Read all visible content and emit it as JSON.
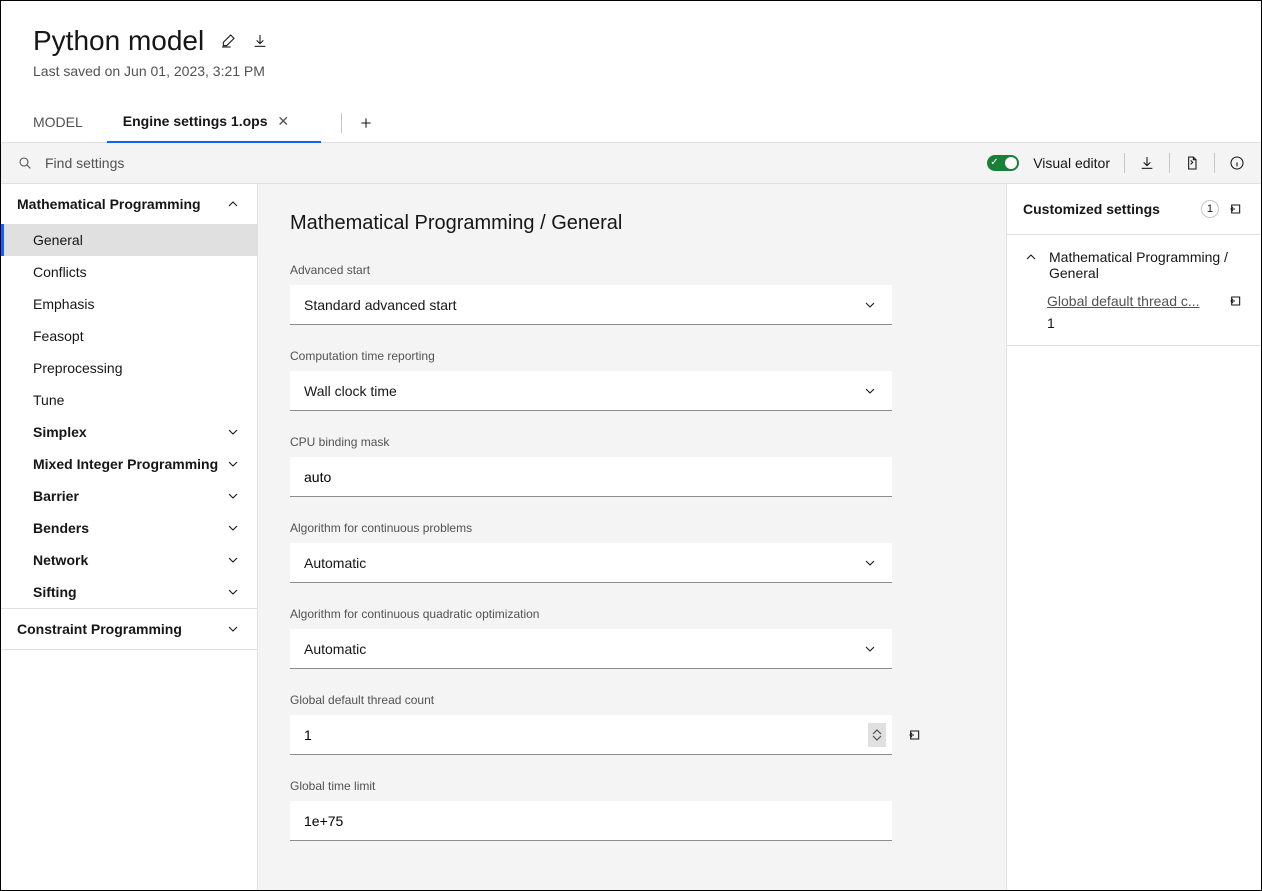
{
  "header": {
    "title": "Python model",
    "subtitle": "Last saved on Jun 01, 2023, 3:21 PM"
  },
  "tabs": {
    "model": "MODEL",
    "engine": "Engine settings 1.ops"
  },
  "toolbar": {
    "search_placeholder": "Find settings",
    "visual_editor": "Visual editor"
  },
  "sidebar": {
    "math_prog": "Mathematical Programming",
    "items": [
      "General",
      "Conflicts",
      "Emphasis",
      "Feasopt",
      "Preprocessing",
      "Tune"
    ],
    "subs": [
      "Simplex",
      "Mixed Integer Programming",
      "Barrier",
      "Benders",
      "Network",
      "Sifting"
    ],
    "constraint_prog": "Constraint Programming"
  },
  "main": {
    "crumb": "Mathematical Programming / General",
    "fields": {
      "adv_start": {
        "label": "Advanced start",
        "value": "Standard advanced start"
      },
      "comp_time": {
        "label": "Computation time reporting",
        "value": "Wall clock time"
      },
      "cpu_mask": {
        "label": "CPU binding mask",
        "value": "auto"
      },
      "algo_cont": {
        "label": "Algorithm for continuous problems",
        "value": "Automatic"
      },
      "algo_quad": {
        "label": "Algorithm for continuous quadratic optimization",
        "value": "Automatic"
      },
      "thread_count": {
        "label": "Global default thread count",
        "value": "1"
      },
      "time_limit": {
        "label": "Global time limit",
        "value": "1e+75"
      }
    }
  },
  "right": {
    "head": "Customized settings",
    "count": "1",
    "group_title": "Mathematical Programming / General",
    "item_label": "Global default thread c...",
    "item_value": "1"
  }
}
